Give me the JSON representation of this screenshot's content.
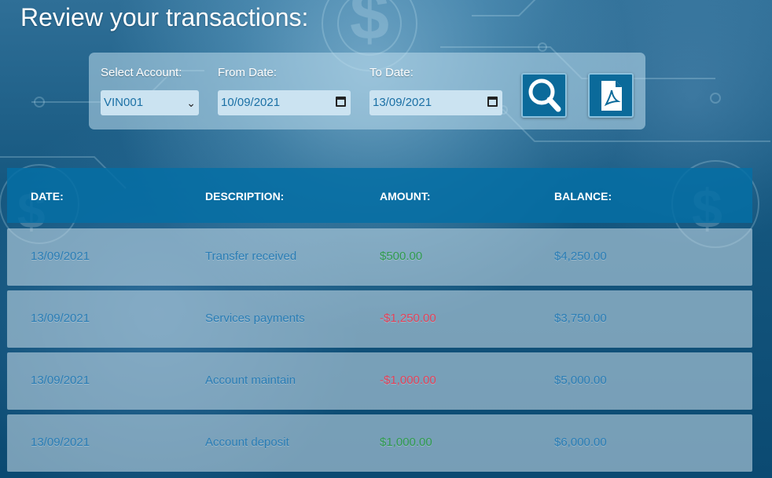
{
  "page": {
    "title": "Review your transactions:"
  },
  "filters": {
    "account_label": "Select Account:",
    "account_value": "VIN001",
    "from_label": "From Date:",
    "from_value": "10/09/2021",
    "to_label": "To Date:",
    "to_value": "13/09/2021",
    "search_icon": "search-icon",
    "pdf_icon": "pdf-icon"
  },
  "table": {
    "headers": [
      "DATE:",
      "DESCRIPTION:",
      "AMOUNT:",
      "BALANCE:"
    ],
    "rows": [
      {
        "date": "13/09/2021",
        "description": "Transfer received",
        "amount": "$500.00",
        "balance": "$4,250.00",
        "type": "credit"
      },
      {
        "date": "13/09/2021",
        "description": "Services payments",
        "amount": "-$1,250.00",
        "balance": "$3,750.00",
        "type": "debit"
      },
      {
        "date": "13/09/2021",
        "description": "Account maintain",
        "amount": "-$1,000.00",
        "balance": "$5,000.00",
        "type": "debit"
      },
      {
        "date": "13/09/2021",
        "description": "Account deposit",
        "amount": "$1,000.00",
        "balance": "$6,000.00",
        "type": "credit"
      }
    ]
  },
  "colors": {
    "credit": "#2f9a4e",
    "debit": "#e0435a",
    "text": "#2a7db5",
    "header": "#0a6ea5"
  }
}
